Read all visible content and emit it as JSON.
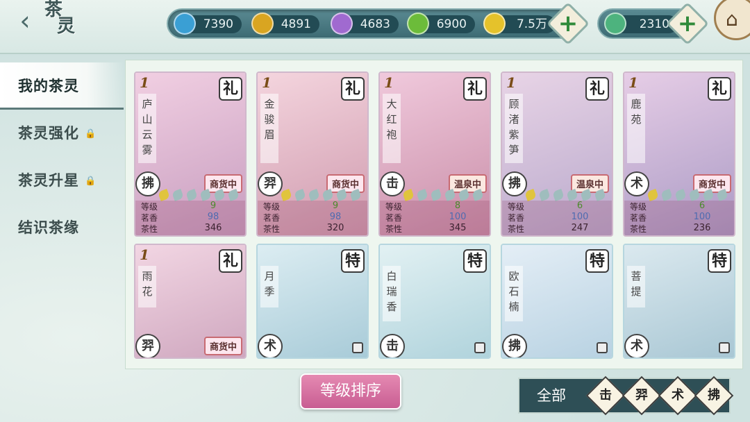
{
  "header": {
    "back_icon": "back-chevron-icon",
    "title_chars": [
      "茶",
      "灵"
    ],
    "resources": [
      {
        "name": "blue-gem",
        "value": "7390",
        "color": "#3a9fd4"
      },
      {
        "name": "gold-gem",
        "value": "4891",
        "color": "#d9a521"
      },
      {
        "name": "purple-gem",
        "value": "4683",
        "color": "#a06ad0"
      },
      {
        "name": "green-gem",
        "value": "6900",
        "color": "#6cbc3a"
      },
      {
        "name": "gold-coin",
        "value": "7.5万",
        "color": "#e5c22b"
      }
    ],
    "secondary_resource": {
      "name": "jade-gem",
      "value": "2310",
      "color": "#4db37e"
    },
    "plus_label": "+",
    "home_icon": "home-icon"
  },
  "sidebar": {
    "items": [
      {
        "label": "我的茶灵",
        "active": true
      },
      {
        "label": "茶灵强化",
        "locked": true
      },
      {
        "label": "茶灵升星",
        "locked": true
      },
      {
        "label": "结识茶缘",
        "locked": false
      }
    ]
  },
  "cards": [
    {
      "name": "庐山云雾",
      "rank": "礼",
      "category": "拂",
      "status": "商货中",
      "level_badge": "1",
      "stars": 1,
      "stats": {
        "level": "9",
        "fragrance": "98",
        "nature": "346"
      },
      "bg": "#e7b4cf"
    },
    {
      "name": "金骏眉",
      "rank": "礼",
      "category": "羿",
      "status": "商货中",
      "level_badge": "1",
      "stars": 1,
      "stats": {
        "level": "9",
        "fragrance": "98",
        "nature": "320"
      },
      "bg": "#ecc3cf"
    },
    {
      "name": "大红袍",
      "rank": "礼",
      "category": "击",
      "status": "温泉中",
      "level_badge": "1",
      "stars": 1,
      "stats": {
        "level": "8",
        "fragrance": "100",
        "nature": "345"
      },
      "bg": "#e9b9cf"
    },
    {
      "name": "顾渚紫笋",
      "rank": "礼",
      "category": "拂",
      "status": "温泉中",
      "level_badge": "1",
      "stars": 1,
      "stats": {
        "level": "6",
        "fragrance": "100",
        "nature": "247"
      },
      "bg": "#dcc2d9"
    },
    {
      "name": "鹿苑",
      "rank": "礼",
      "category": "术",
      "status": "商货中",
      "level_badge": "1",
      "stars": 1,
      "stats": {
        "level": "6",
        "fragrance": "100",
        "nature": "236"
      },
      "bg": "#d9b7d6"
    },
    {
      "name": "雨花",
      "rank": "礼",
      "category": "羿",
      "status": "商货中",
      "level_badge": "1",
      "bg": "#eac6d8"
    },
    {
      "name": "月季",
      "rank": "特",
      "category": "术",
      "bg": "#c6e0ea"
    },
    {
      "name": "白瑞香",
      "rank": "特",
      "category": "击",
      "bg": "#cfe8ec"
    },
    {
      "name": "欧石楠",
      "rank": "特",
      "category": "拂",
      "bg": "#cfe4ee"
    },
    {
      "name": "菩提",
      "rank": "特",
      "category": "术",
      "bg": "#c5dfe9"
    }
  ],
  "stat_labels": {
    "level": "等级",
    "fragrance": "茗香",
    "nature": "茶性"
  },
  "bottom": {
    "sort_label": "等级排序",
    "filter_all_label": "全部",
    "filter_buttons": [
      "击",
      "羿",
      "术",
      "拂"
    ]
  }
}
